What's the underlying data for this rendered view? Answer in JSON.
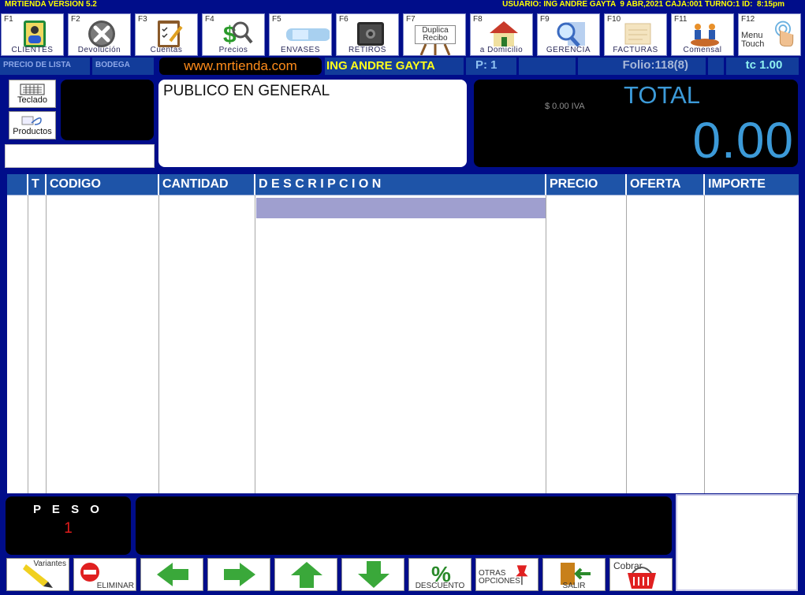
{
  "title": {
    "app": "MRTIENDA VERSION 5.2",
    "status": "USUARIO: ING ANDRE GAYTA  9 ABR,2021 CAJA:001 TURNO:1 ID:  8:15pm"
  },
  "fkeys": [
    {
      "key": "F1",
      "label": "CLIENTES",
      "icon": "customer-book-icon"
    },
    {
      "key": "F2",
      "label": "Devolución",
      "icon": "cancel-x-icon"
    },
    {
      "key": "F3",
      "label": "Cuentas",
      "icon": "checklist-icon"
    },
    {
      "key": "F4",
      "label": "Precios",
      "icon": "price-lookup-icon"
    },
    {
      "key": "F5",
      "label": "ENVASES",
      "icon": "water-bottle-icon"
    },
    {
      "key": "F6",
      "label": "RETIROS",
      "icon": "safe-icon"
    },
    {
      "key": "F7",
      "label": "Duplica Recibo",
      "icon": "receipt-sign-icon"
    },
    {
      "key": "F8",
      "label": "a Domicilio",
      "icon": "house-icon"
    },
    {
      "key": "F9",
      "label": "GERENCIA",
      "icon": "magnifier-icon"
    },
    {
      "key": "F10",
      "label": "FACTURAS",
      "icon": "invoice-box-icon"
    },
    {
      "key": "F11",
      "label": "Comensal",
      "icon": "diners-icon"
    },
    {
      "key": "F12",
      "label": "Menu Touch",
      "icon": "touch-hand-icon"
    }
  ],
  "info": {
    "price_list": "PRECIO DE LISTA",
    "warehouse": "BODEGA",
    "website": "www.mrtienda.com",
    "user": "ING ANDRE GAYTA",
    "page": "P:  1",
    "folio": "Folio:118(8)",
    "exchange": "tc 1.00"
  },
  "side": {
    "keyboard": "Teclado",
    "products": "Productos",
    "search_value": ""
  },
  "customer": "PUBLICO EN GENERAL",
  "total": {
    "iva": "$ 0.00 IVA",
    "label": "TOTAL",
    "amount": "0.00"
  },
  "table": {
    "headers": [
      "",
      "T",
      "CODIGO",
      "CANTIDAD",
      "D E S C R I P C I O N",
      "PRECIO",
      "OFERTA",
      "IMPORTE"
    ]
  },
  "weight": {
    "label": "P E S O",
    "value": "1"
  },
  "bottom": [
    {
      "label": "Variantes",
      "icon": "highlighter-icon",
      "name": "variantes-button"
    },
    {
      "label": "ELIMINAR",
      "icon": "no-entry-icon",
      "name": "eliminar-button"
    },
    {
      "label": "",
      "icon": "arrow-left-icon",
      "name": "prev-button"
    },
    {
      "label": "",
      "icon": "arrow-right-icon",
      "name": "next-button"
    },
    {
      "label": "",
      "icon": "arrow-up-icon",
      "name": "up-button"
    },
    {
      "label": "",
      "icon": "arrow-down-icon",
      "name": "down-button"
    },
    {
      "label": "DESCUENTO",
      "icon": "percent-icon",
      "name": "descuento-button"
    },
    {
      "label": "OTRAS OPCIONES",
      "icon": "pushpin-icon",
      "name": "otras-opciones-button"
    },
    {
      "label": "SALIR",
      "icon": "exit-door-icon",
      "name": "salir-button"
    },
    {
      "label": "Cobrar",
      "icon": "basket-icon",
      "name": "cobrar-button"
    }
  ],
  "colors": {
    "background": "#000d8a",
    "header": "#1e54a8",
    "total": "#3c9ad8",
    "accent": "#ffff1a"
  }
}
